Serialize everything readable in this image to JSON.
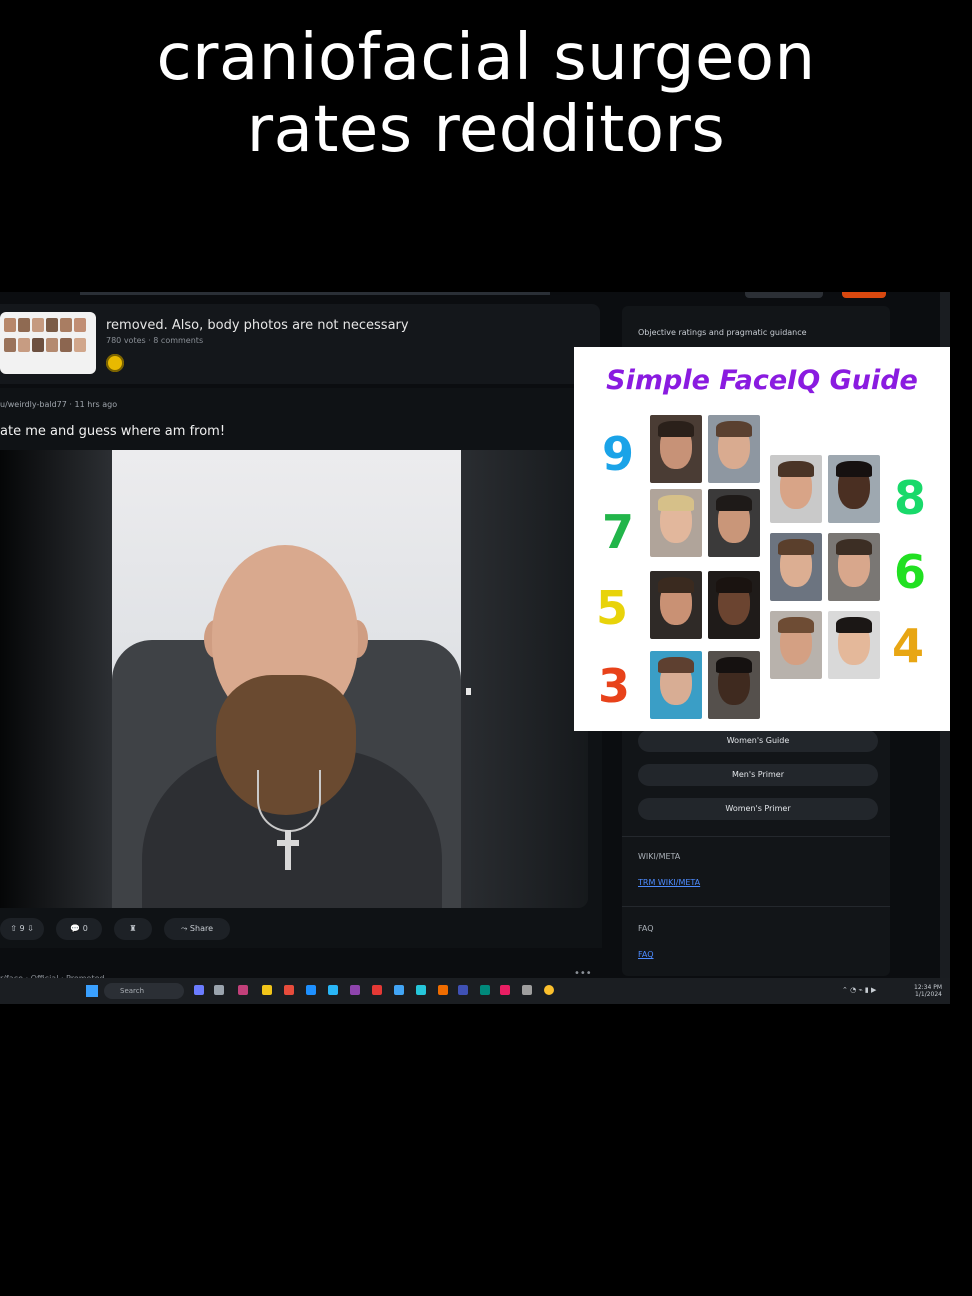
{
  "caption": {
    "line1": "craniofacial surgeon",
    "line2": "rates redditors"
  },
  "feed": {
    "prev_post": {
      "title": "removed. Also, body photos are not necessary",
      "meta": "780 votes · 8 comments"
    },
    "post": {
      "author": "u/weirdly-bald77 · 11 hrs ago",
      "title": "ate me and guess where am from!",
      "actions": {
        "upvote": "9",
        "comments": "0",
        "share": "Share"
      }
    },
    "subline": "r/face · Official · Promoted"
  },
  "sidebar": {
    "heading": "Objective ratings and pragmatic guidance",
    "buttons": [
      "Women's Guide",
      "Men's Primer",
      "Women's Primer"
    ],
    "wiki_label": "WIKI/META",
    "wiki_link": "TRM WIKI/META",
    "faq_label": "FAQ",
    "faq_link": "FAQ"
  },
  "guide": {
    "title": "Simple FaceIQ Guide",
    "left_numbers": [
      "9",
      "7",
      "5",
      "3"
    ],
    "right_numbers": [
      "8",
      "6",
      "4"
    ],
    "colors": {
      "9": "#1aa3e8",
      "7": "#22b54a",
      "5": "#e8d30a",
      "3": "#e8421a",
      "8": "#19d96a",
      "6": "#21e021",
      "4": "#e8a613",
      "title": "#8a1be0"
    }
  },
  "taskbar": {
    "search": "Search",
    "time": "12:34 PM",
    "date": "1/1/2024"
  }
}
